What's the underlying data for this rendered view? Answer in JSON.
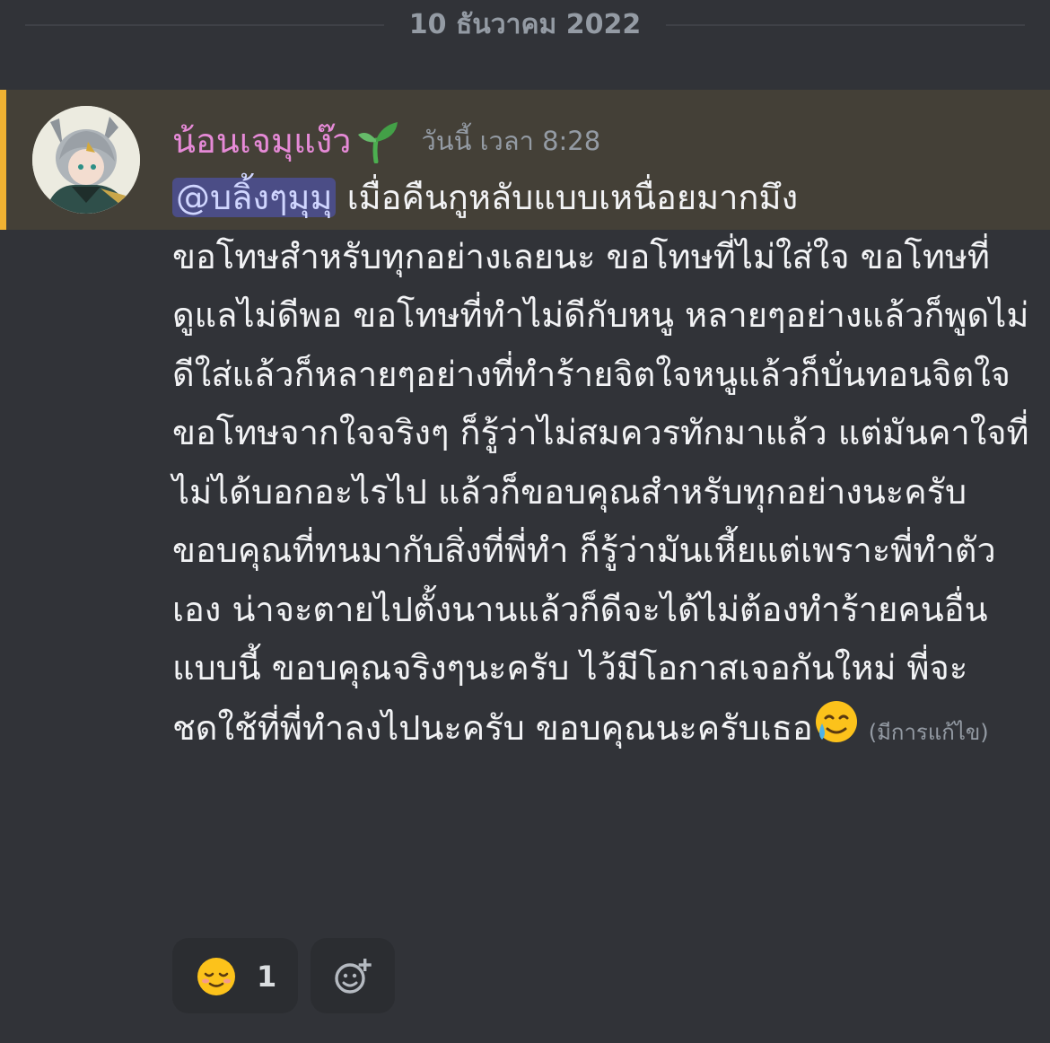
{
  "date_divider": "10 ธันวาคม 2022",
  "message": {
    "username": "น้อนเจมุแง๊ว",
    "username_emoji": "seedling-icon",
    "timestamp": "วันนี้ เวลา 8:28",
    "mention": "@บลิ้งๆมุมุ",
    "first_line": "เมื่อคืนกูหลับแบบเหนื่อยมากมึง",
    "body": "ขอโทษสำหรับทุกอย่างเลยนะ ขอโทษที่ไม่ใส่ใจ ขอโทษที่ดูแลไม่ดีพอ ขอโทษที่ทำไม่ดีกับหนู หลายๆอย่างแล้วก็พูดไม่ดีใส่แล้วก็หลายๆอย่างที่ทำร้ายจิตใจหนูแล้วก็บั่นทอนจิตใจ ขอโทษจากใจจริงๆ ก็รู้ว่าไม่สมควรทักมาแล้ว แต่มันคาใจที่ไม่ได้บอกอะไรไป แล้วก็ขอบคุณสำหรับทุกอย่างนะครับ ขอบคุณที่ทนมากับสิ่งที่พี่ทำ ก็รู้ว่ามันเหี้ยแต่เพราะพี่ทำตัวเอง น่าจะตายไปตั้งนานแล้วก็ดีจะได้ไม่ต้องทำร้ายคนอื่นแบบนี้ ขอบคุณจริงๆนะครับ ไว้มีโอกาสเจอกันใหม่ พี่จะชดใช้ที่พี่ทำลงไปนะครับ ขอบคุณนะครับเธอ",
    "trailing_emoji": "crying-smile-emoji",
    "edited_label": "(มีการแก้ไข)",
    "accent_color": "#f0b232",
    "username_color": "#e68ad7"
  },
  "reactions": [
    {
      "emoji": "relieved-face-emoji",
      "count": "1"
    }
  ],
  "add_reaction": "add-reaction-icon"
}
